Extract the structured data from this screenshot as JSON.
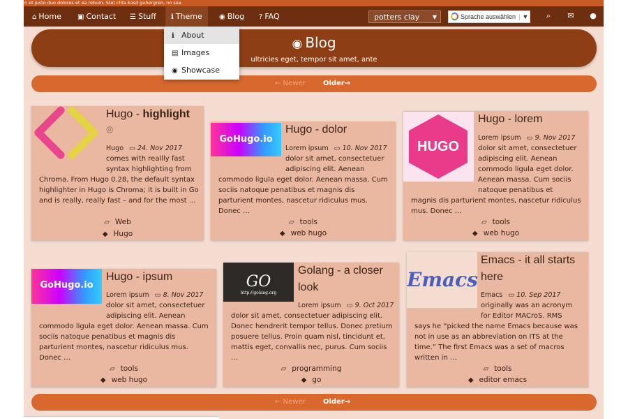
{
  "top_strip": {
    "text_before": "n et justo duo dolores et ea rebum. Stet clita ",
    "text_italic": "kasd gubergren",
    "text_after": ", no sea"
  },
  "nav": {
    "home": "Home",
    "contact": "Contact",
    "stuff": "Stuff",
    "theme": "Theme",
    "blog": "Blog",
    "faq": "FAQ",
    "theme_select_value": "potters clay",
    "translate_label": "Sprache auswählen",
    "translate_sep": "|",
    "translate_arrow": "▼"
  },
  "dropdown": {
    "items": [
      {
        "label": "About"
      },
      {
        "label": "Images"
      },
      {
        "label": "Showcase"
      }
    ]
  },
  "hero": {
    "title": "Blog",
    "subtitle": "ultricies eget, tempor sit amet, ante"
  },
  "pager": {
    "newer": "← Newer",
    "older": "Older→"
  },
  "posts": [
    {
      "title_prefix": "Hugo - ",
      "title_bold": "highlight",
      "author": "Hugo",
      "date": "24. Nov 2017",
      "body_top": "comes with reallly fast syntax highlighting from",
      "body": "Chroma. From Hugo 0.28, the default syntax highlighter in Hugo is Chroma; it is built in Go and is really, really fast – and for the most …",
      "category": "Web",
      "tags": "Hugo"
    },
    {
      "title": "Hugo - dolor",
      "author": "Lorem ipsum",
      "date": "10. Nov 2017",
      "body_top": "dolor sit amet, consectetuer adipiscing elit. Aenean",
      "body": "commodo ligula eget dolor. Aenean massa. Cum sociis natoque penatibus et magnis dis parturient montes, nascetur ridiculus mus. Donec …",
      "category": "tools",
      "tags": "web  hugo",
      "image": "GoHugo.io"
    },
    {
      "title": "Hugo - lorem",
      "author": "Lorem ipsum",
      "date": "9. Nov 2017",
      "body_top": "dolor sit amet, consectetuer adipiscing elit. Aenean commodo ligula eget dolor. Aenean massa. Cum sociis natoque penatibus et",
      "body": "magnis dis parturient montes, nascetur ridiculus mus. Donec …",
      "category": "tools",
      "tags": "web  hugo",
      "image": "HUGO"
    },
    {
      "title": "Hugo - ipsum",
      "author": "Lorem ipsum",
      "date": "8. Nov 2017",
      "body_top": "dolor sit amet, consectetuer adipiscing elit. Aenean",
      "body": "commodo ligula eget dolor. Aenean massa. Cum sociis natoque penatibus et magnis dis parturient montes, nascetur ridiculus mus. Donec …",
      "category": "tools",
      "tags": "web  hugo",
      "image": "GoHugo.io"
    },
    {
      "title": "Golang - a closer look",
      "author": "Lorem ipsum",
      "date": "9. Oct 2017",
      "body": "dolor sit amet, consectetuer adipiscing elit. Donec hendrerit tempor tellus. Donec pretium posuere tellus. Proin quam nisl, tincidunt et, mattis eget, convallis nec, purus. Cum sociis …",
      "category": "programming",
      "tags": "go",
      "image": "GO",
      "image_sub": "http://golang.org"
    },
    {
      "title": "Emacs - it all starts here",
      "author": "Emacs",
      "date": "10. Sep 2017",
      "body_top": "originally was an acronym for Editor MACroS. RMS",
      "body": "says he “picked the name Emacs because was not in use as an abbreviation on ITS at the time.” The first Emacs was a set of macros written in …",
      "category": "tools",
      "tags": "editor  emacs",
      "image": "Emacs"
    }
  ],
  "colors": {
    "navbar": "#6e2e10",
    "accent": "#d9682e",
    "hero": "#8e3e14",
    "card": "#eab7a0",
    "page_bg": "#f4dcd0"
  }
}
